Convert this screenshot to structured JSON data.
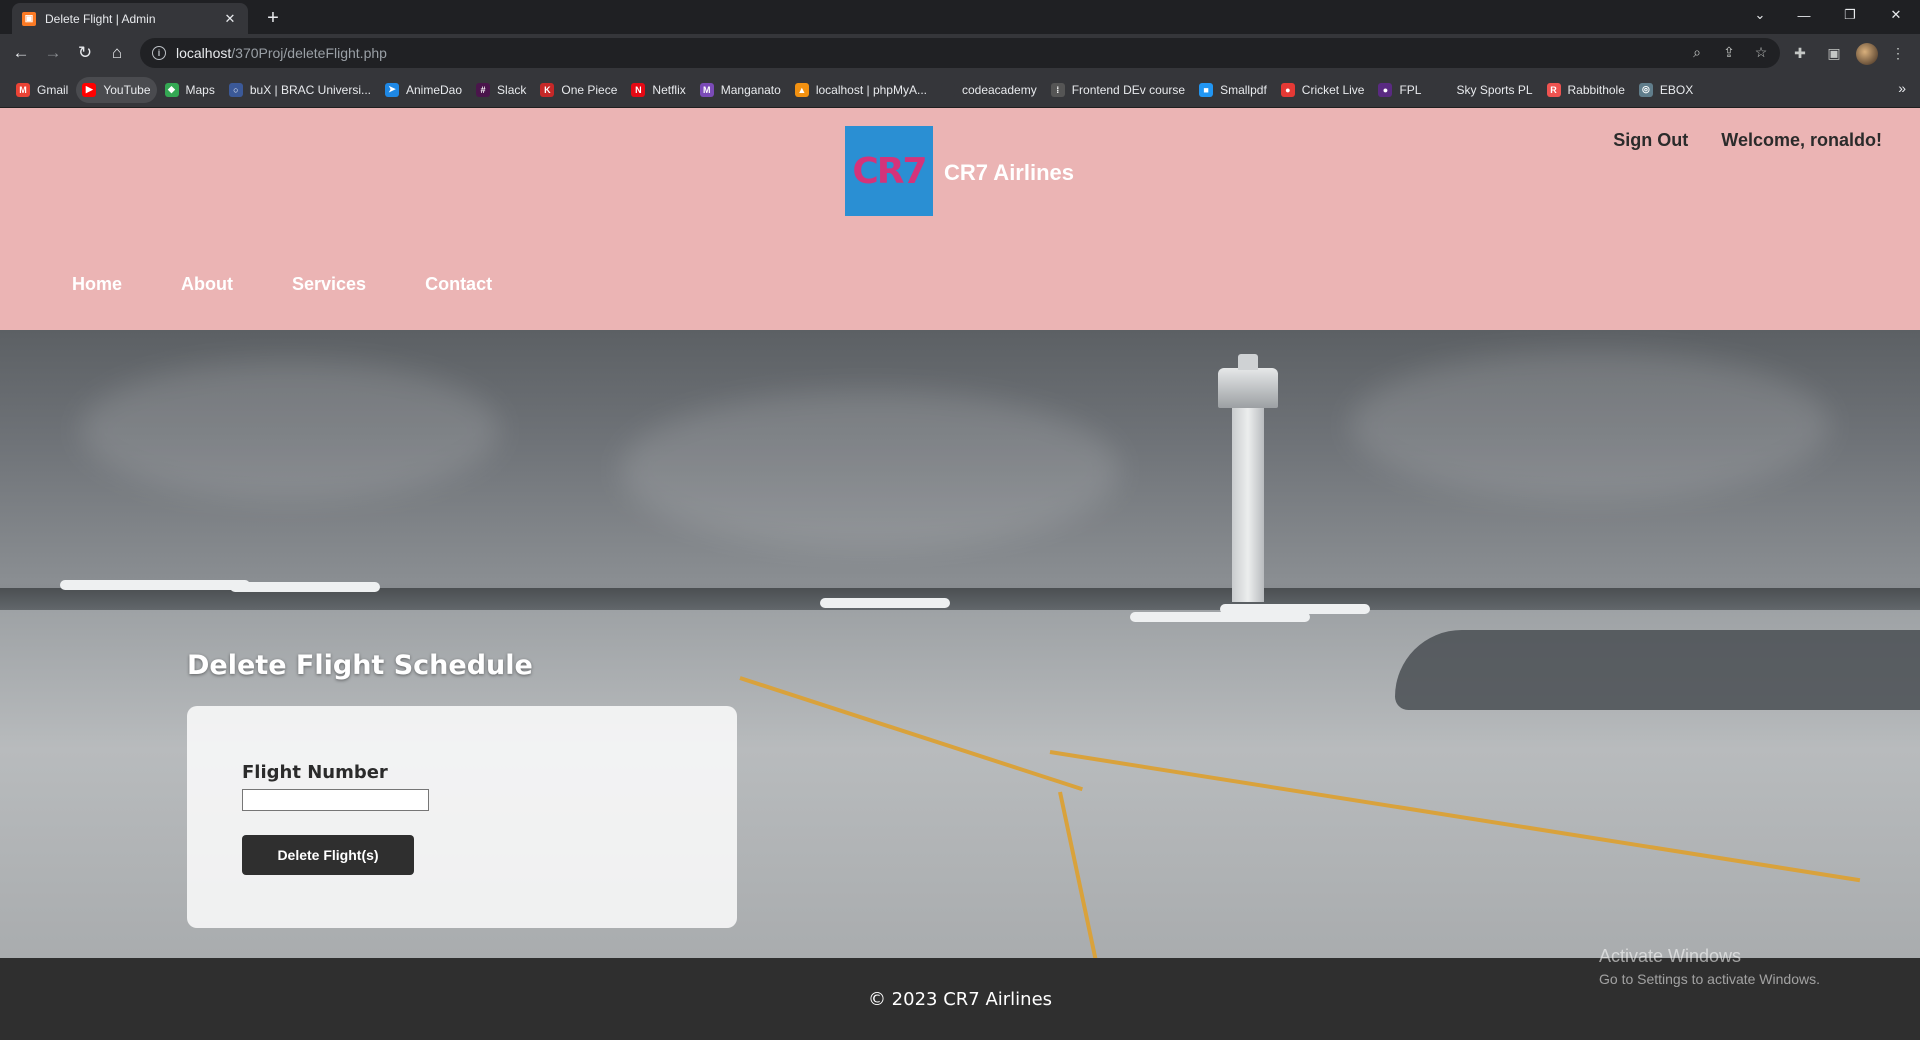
{
  "browser": {
    "tab_title": "Delete Flight | Admin",
    "url_host": "localhost",
    "url_path": "/370Proj/deleteFlight.php",
    "bookmarks": [
      {
        "label": "Gmail",
        "color": "#ea4335",
        "icon": "M"
      },
      {
        "label": "YouTube",
        "color": "#ff0000",
        "icon": "▶"
      },
      {
        "label": "Maps",
        "color": "#34a853",
        "icon": "◆"
      },
      {
        "label": "buX | BRAC Universi...",
        "color": "#3b5998",
        "icon": "○"
      },
      {
        "label": "AnimeDao",
        "color": "#1e88e5",
        "icon": "➤"
      },
      {
        "label": "Slack",
        "color": "#4a154b",
        "icon": "#"
      },
      {
        "label": "One Piece",
        "color": "#c62828",
        "icon": "K"
      },
      {
        "label": "Netflix",
        "color": "#e50914",
        "icon": "N"
      },
      {
        "label": "Manganato",
        "color": "#7b4bb7",
        "icon": "M"
      },
      {
        "label": "localhost | phpMyA...",
        "color": "#f29111",
        "icon": "▲"
      },
      {
        "label": "codeacademy",
        "color": "#35363a",
        "icon": ""
      },
      {
        "label": "Frontend DEv course",
        "color": "#555",
        "icon": "⁞"
      },
      {
        "label": "Smallpdf",
        "color": "#2196f3",
        "icon": "■"
      },
      {
        "label": "Cricket Live",
        "color": "#e53935",
        "icon": "●"
      },
      {
        "label": "FPL",
        "color": "#5a2a82",
        "icon": "●"
      },
      {
        "label": "Sky Sports PL",
        "color": "#35363a",
        "icon": ""
      },
      {
        "label": "Rabbithole",
        "color": "#ef5350",
        "icon": "R"
      },
      {
        "label": "EBOX",
        "color": "#607d8b",
        "icon": "◎"
      }
    ]
  },
  "site": {
    "brand_logo_text": "CR7",
    "brand": "CR7 Airlines",
    "sign_out": "Sign Out",
    "welcome": "Welcome, ronaldo!",
    "nav": [
      "Home",
      "About",
      "Services",
      "Contact"
    ]
  },
  "form": {
    "title": "Delete Flight Schedule",
    "field_label": "Flight Number",
    "field_value": "",
    "submit_label": "Delete Flight(s)"
  },
  "footer": {
    "text": "© 2023 CR7 Airlines"
  },
  "os_overlay": {
    "line1": "Activate Windows",
    "line2": "Go to Settings to activate Windows."
  }
}
